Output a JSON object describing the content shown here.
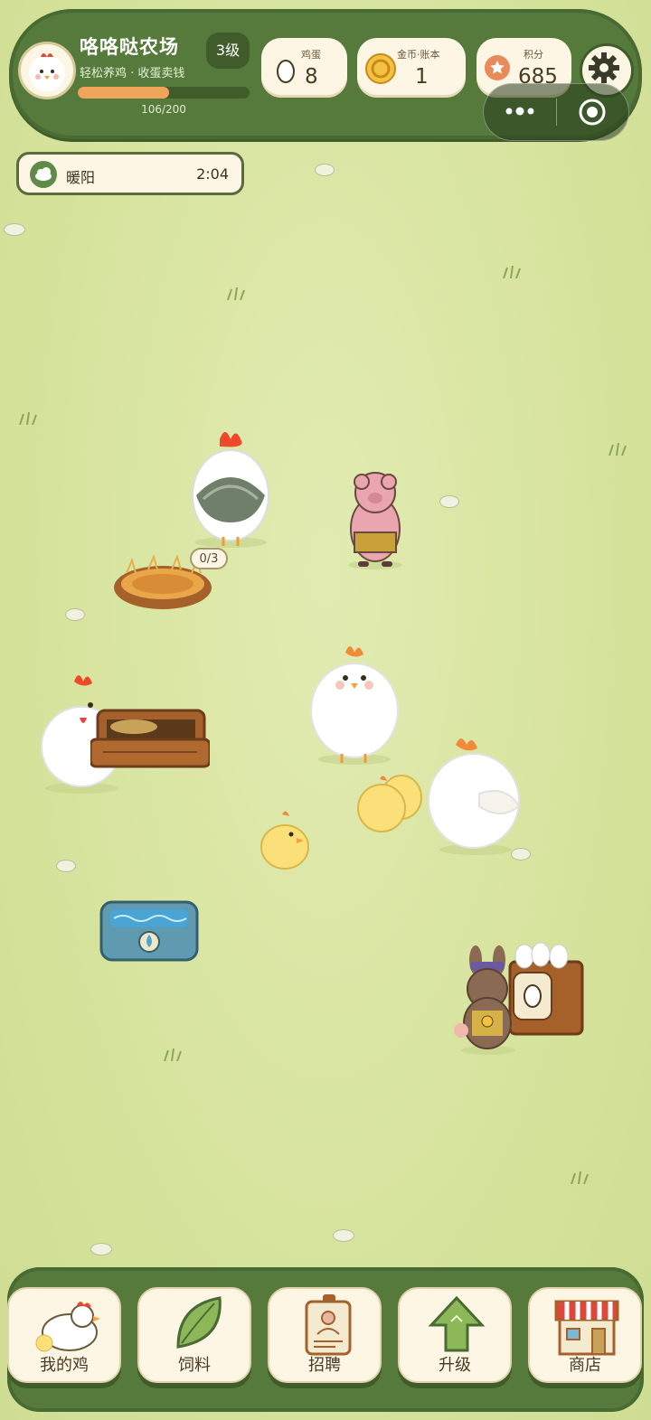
{
  "farm": {
    "name": "咯咯哒农场",
    "subtitle": "轻松养鸡 · 收蛋卖钱",
    "level": "3级",
    "xp_text": "106/200",
    "xp_progress": 0.53
  },
  "resources": {
    "eggs": {
      "label": "鸡蛋",
      "value": "8"
    },
    "gold": {
      "label": "金币·账本",
      "value": "1"
    },
    "points": {
      "label": "积分",
      "value": "685"
    }
  },
  "weather": {
    "name": "暖阳",
    "time": "2:04"
  },
  "nest": {
    "counter": "0/3"
  },
  "nav": [
    {
      "label": "我的鸡",
      "icon": "chicken-icon"
    },
    {
      "label": "饲料",
      "icon": "leaf-icon"
    },
    {
      "label": "招聘",
      "icon": "id-badge-icon"
    },
    {
      "label": "升级",
      "icon": "up-arrow-icon"
    },
    {
      "label": "商店",
      "icon": "shop-icon"
    }
  ],
  "colors": {
    "bar_green": "#557a3b",
    "cream": "#fdf6e4",
    "grass": "#d6e39c",
    "xp_orange": "#f0a55a"
  }
}
